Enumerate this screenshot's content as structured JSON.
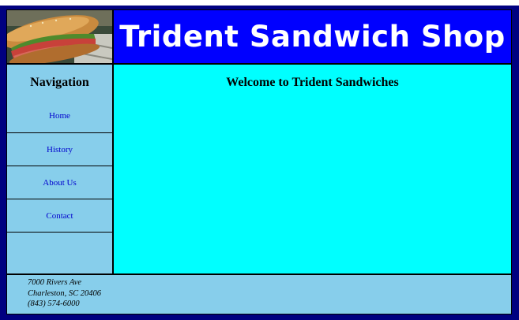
{
  "header": {
    "title": "Trident Sandwich Shop"
  },
  "navigation": {
    "heading": "Navigation",
    "items": [
      {
        "label": "Home"
      },
      {
        "label": "History"
      },
      {
        "label": "About Us"
      },
      {
        "label": "Contact"
      }
    ]
  },
  "main": {
    "heading": "Welcome to Trident Sandwiches"
  },
  "footer": {
    "address_line1": "7000 Rivers Ave",
    "address_line2": "Charleston, SC 20406",
    "phone": "(843) 574-6000"
  },
  "colors": {
    "page_background": "#000080",
    "header_background": "#0000ff",
    "nav_background": "#87ceeb",
    "main_background": "#00ffff",
    "link_color": "#0000cd"
  },
  "icons": {
    "logo": "sandwich-image"
  }
}
